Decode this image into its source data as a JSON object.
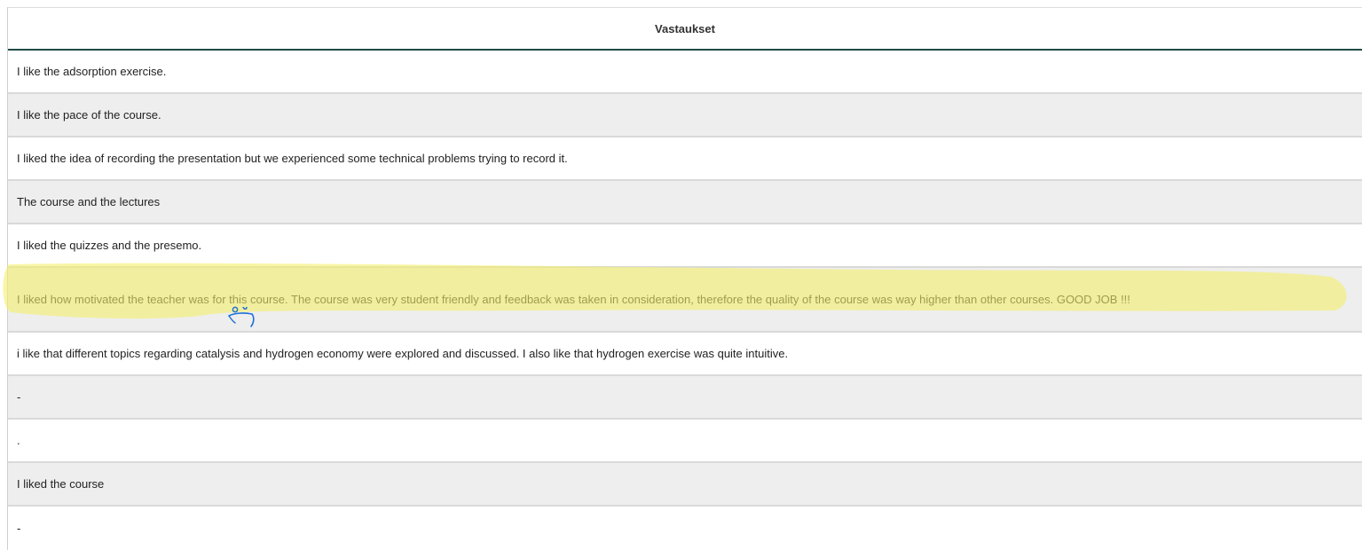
{
  "table": {
    "header": "Vastaukset",
    "rows": [
      "I like the adsorption exercise.",
      "I like the pace of the course.",
      "I liked the idea of recording the presentation but we experienced some technical problems trying to record it.",
      "The course and the lectures",
      "I liked the quizzes and the presemo.",
      "I liked how motivated the teacher was for this course. The course was very student friendly and feedback was taken in consideration, therefore the quality of the course was way higher than other courses. GOOD JOB !!!",
      "i like that different topics regarding catalysis and hydrogen economy were explored and discussed. I also like that hydrogen exercise was quite intuitive.",
      "-",
      ".",
      "I liked the course",
      "-"
    ]
  },
  "annotation": {
    "highlight_color": "#f3f06a",
    "pen_color": "#1e6fd9",
    "mark": "smiley-doodle"
  }
}
